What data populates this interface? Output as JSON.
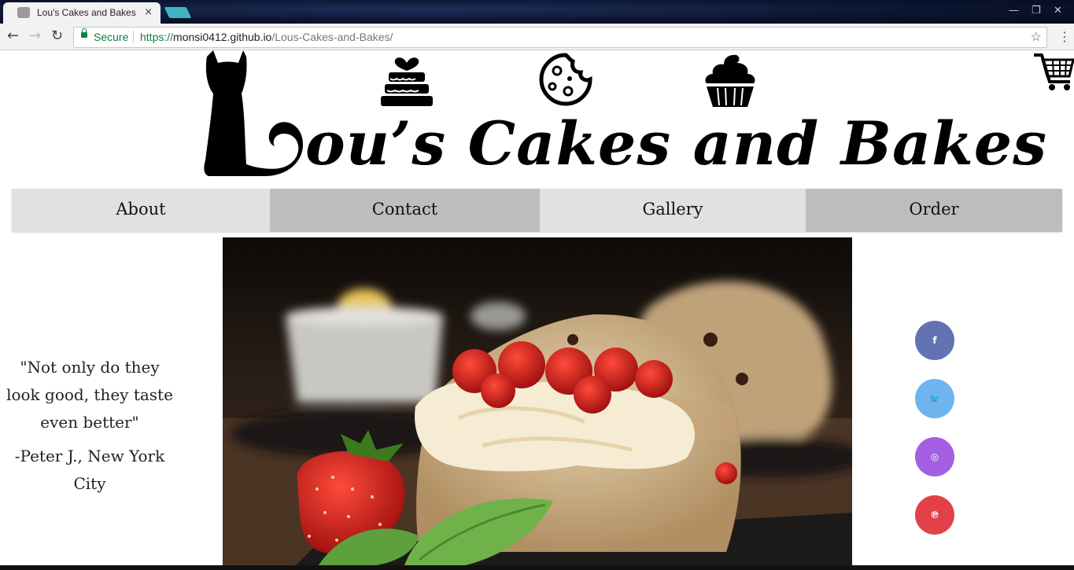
{
  "browser": {
    "tab_title": "Lou's Cakes and Bakes",
    "tab_close": "×",
    "secure_label": "Secure",
    "url_scheme": "https://",
    "url_host": "monsi0412.github.io",
    "url_path": "/Lous-Cakes-and-Bakes/",
    "back": "←",
    "forward": "→",
    "reload": "↻",
    "bookmark": "☆",
    "menu": "⋮",
    "min": "—",
    "max": "❐",
    "close": "✕"
  },
  "site": {
    "brand_rest": "ou’s Cakes and Bakes",
    "nav": {
      "about": "About",
      "contact": "Contact",
      "gallery": "Gallery",
      "order": "Order"
    },
    "testimonial": {
      "quote": "\"Not only do they look good, they taste even better\"",
      "author": "-Peter J., New York City"
    },
    "social": {
      "facebook": {
        "glyph": "f",
        "color": "#6272b3"
      },
      "twitter": {
        "glyph": "🐦",
        "color": "#6eb4ef"
      },
      "instagram": {
        "glyph": "◎",
        "color": "#a35ee4"
      },
      "pinterest": {
        "glyph": "℗",
        "color": "#e2414a"
      }
    }
  }
}
